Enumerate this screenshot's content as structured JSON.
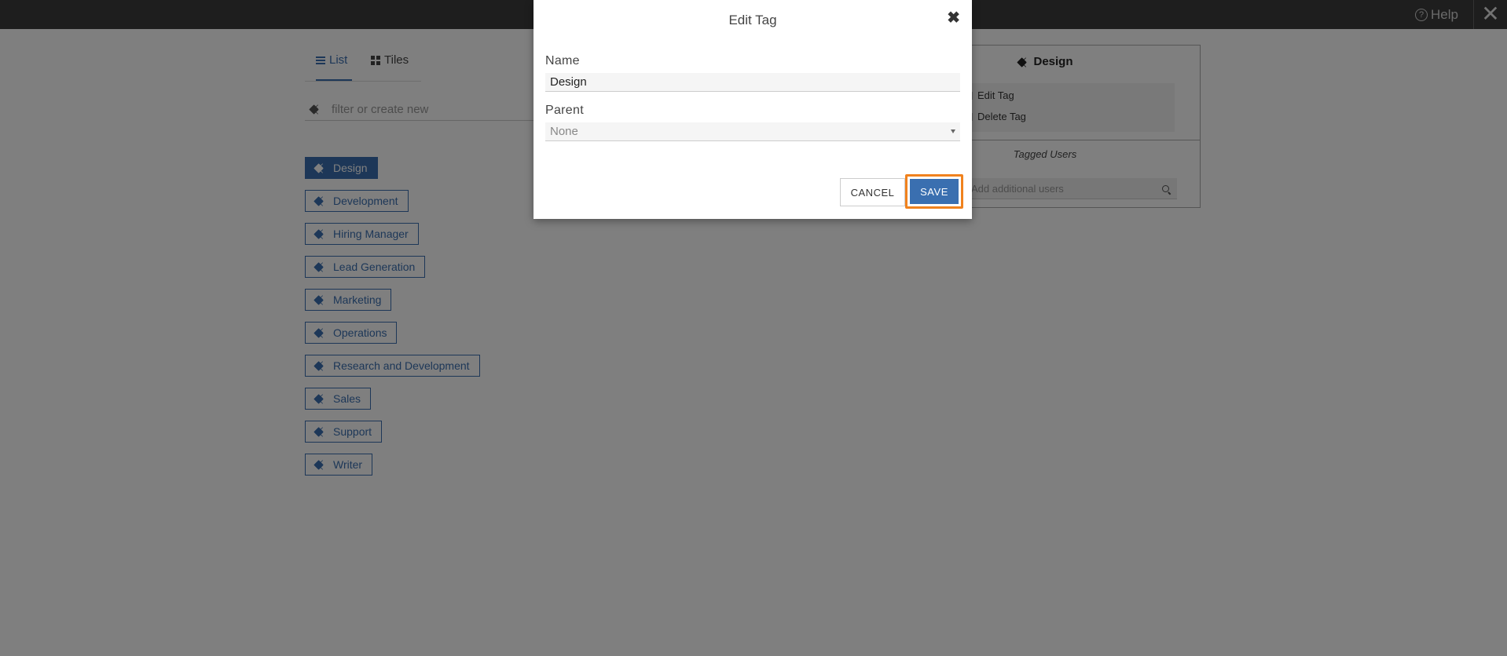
{
  "topbar": {
    "help_label": "Help"
  },
  "view_tabs": [
    {
      "label": "List"
    },
    {
      "label": "Tiles"
    }
  ],
  "filter": {
    "placeholder": "filter or create new"
  },
  "tags": [
    {
      "label": "Design",
      "selected": true
    },
    {
      "label": "Development"
    },
    {
      "label": "Hiring Manager"
    },
    {
      "label": "Lead Generation"
    },
    {
      "label": "Marketing"
    },
    {
      "label": "Operations"
    },
    {
      "label": "Research and Development"
    },
    {
      "label": "Sales"
    },
    {
      "label": "Support"
    },
    {
      "label": "Writer"
    }
  ],
  "detail": {
    "title": "Design",
    "edit_label": "Edit Tag",
    "delete_label": "Delete Tag",
    "tagged_users_label": "Tagged Users",
    "search_placeholder": "Add additional users"
  },
  "modal": {
    "title": "Edit Tag",
    "name_label": "Name",
    "name_value": "Design",
    "parent_label": "Parent",
    "parent_value": "None",
    "cancel_label": "CANCEL",
    "save_label": "SAVE"
  },
  "colors": {
    "accent": "#3a6fb0",
    "focus_ring": "#f0821e",
    "topbar": "#3c3c3c"
  }
}
